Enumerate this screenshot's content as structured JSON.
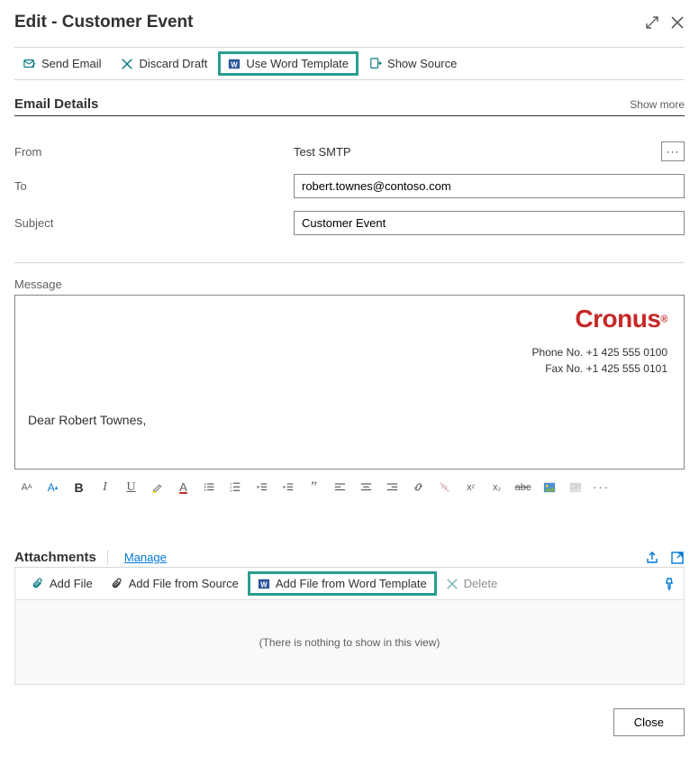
{
  "header": {
    "title": "Edit - Customer Event"
  },
  "toolbar": {
    "send_email": "Send Email",
    "discard_draft": "Discard Draft",
    "use_word_template": "Use Word Template",
    "show_source": "Show Source"
  },
  "section": {
    "email_details": "Email Details",
    "show_more": "Show more"
  },
  "form": {
    "from_label": "From",
    "from_value": "Test SMTP",
    "to_label": "To",
    "to_value": "robert.townes@contoso.com",
    "subject_label": "Subject",
    "subject_value": "Customer Event"
  },
  "message": {
    "label": "Message",
    "logo": "Cronus",
    "logo_reg": "®",
    "phone": "Phone No. +1 425 555 0100",
    "fax": "Fax No. +1 425 555 0101",
    "greeting": "Dear Robert Townes,"
  },
  "attachments": {
    "title": "Attachments",
    "manage": "Manage",
    "add_file": "Add File",
    "add_from_source": "Add File from Source",
    "add_from_word": "Add File from Word Template",
    "delete": "Delete",
    "empty": "(There is nothing to show in this view)"
  },
  "footer": {
    "close": "Close"
  }
}
